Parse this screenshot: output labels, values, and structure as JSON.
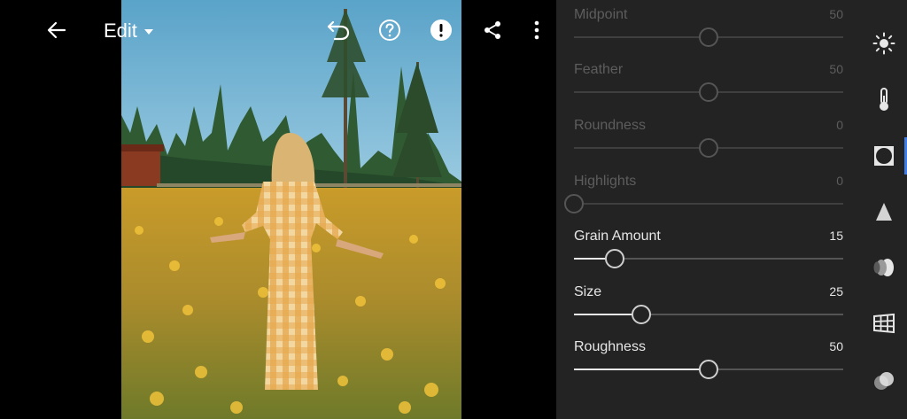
{
  "header": {
    "edit_label": "Edit"
  },
  "panel": {
    "sliders": [
      {
        "label": "Midpoint",
        "value": "50",
        "level": 0.5,
        "enabled": false
      },
      {
        "label": "Feather",
        "value": "50",
        "level": 0.5,
        "enabled": false
      },
      {
        "label": "Roundness",
        "value": "0",
        "level": 0.5,
        "enabled": false
      },
      {
        "label": "Highlights",
        "value": "0",
        "level": 0.0,
        "enabled": false
      },
      {
        "label": "Grain Amount",
        "value": "15",
        "level": 0.15,
        "enabled": true
      },
      {
        "label": "Size",
        "value": "25",
        "level": 0.25,
        "enabled": true
      },
      {
        "label": "Roughness",
        "value": "50",
        "level": 0.5,
        "enabled": true
      }
    ]
  },
  "tools": {
    "items": [
      "light-icon",
      "color-icon",
      "effects-icon",
      "detail-icon",
      "optics-icon",
      "geometry-icon",
      "presets-icon"
    ],
    "active": "effects-icon"
  },
  "colors": {
    "panel_bg": "#232323",
    "accent": "#3f7ce8"
  }
}
